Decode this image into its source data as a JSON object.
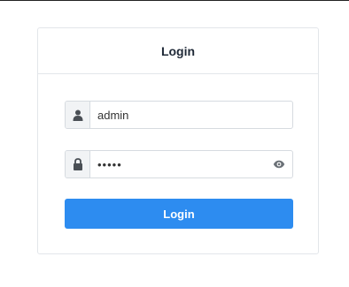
{
  "header": {
    "title": "Login"
  },
  "form": {
    "username": {
      "value": "admin",
      "icon": "user-icon"
    },
    "password": {
      "masked_value": "•••••",
      "icon": "lock-icon",
      "toggle_icon": "eye-icon"
    },
    "submit_label": "Login"
  },
  "colors": {
    "accent": "#2d8cf0",
    "border": "#e3e6ea",
    "addon_bg": "#f1f3f5",
    "icon": "#555a60"
  }
}
